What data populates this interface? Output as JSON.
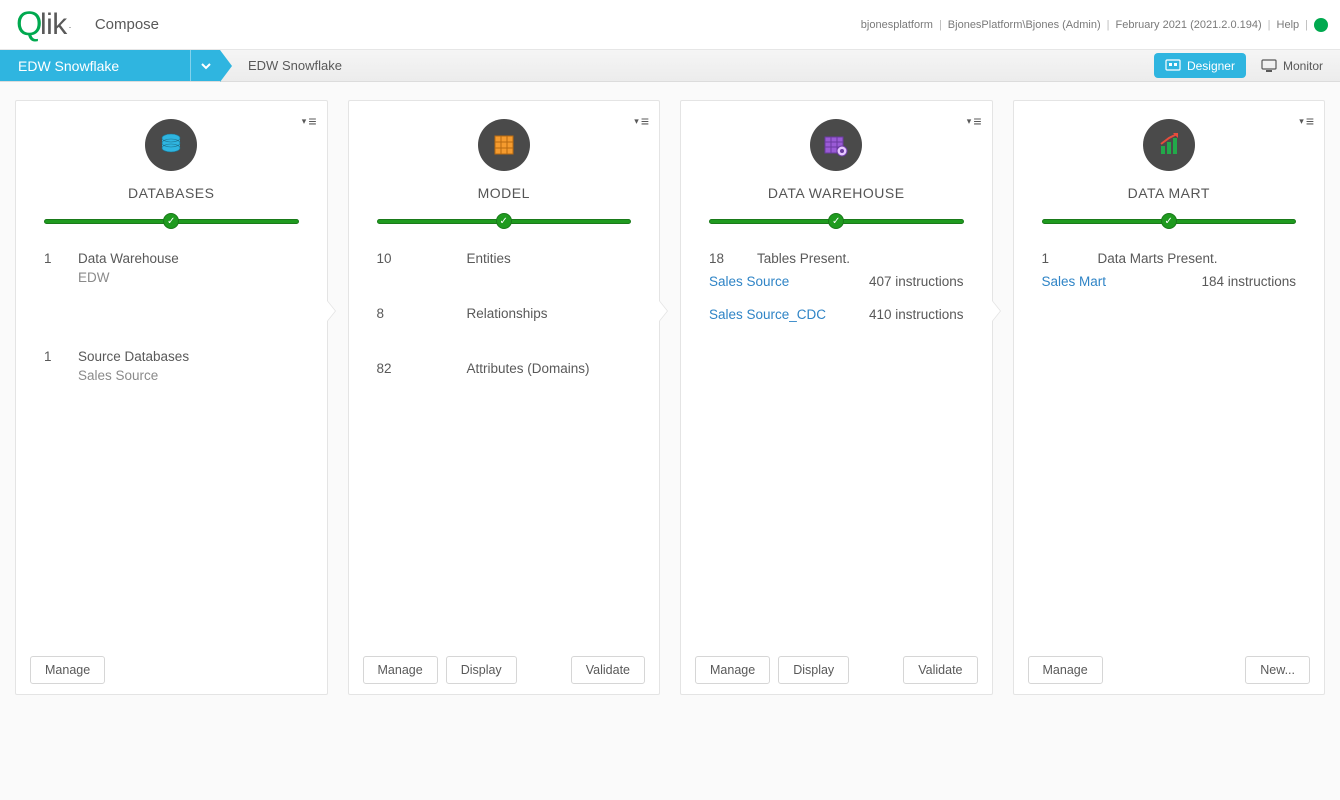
{
  "header": {
    "logo_lik": "lik",
    "app_name": "Compose",
    "platform": "bjonesplatform",
    "user": "BjonesPlatform\\Bjones (Admin)",
    "version": "February 2021 (2021.2.0.194)",
    "help": "Help"
  },
  "nav": {
    "primary": "EDW Snowflake",
    "secondary": "EDW Snowflake",
    "designer": "Designer",
    "monitor": "Monitor"
  },
  "cards": {
    "databases": {
      "title": "DATABASES",
      "dw_count": "1",
      "dw_label": "Data Warehouse",
      "dw_sub": "EDW",
      "src_count": "1",
      "src_label": "Source Databases",
      "src_sub": "Sales Source",
      "btn_manage": "Manage"
    },
    "model": {
      "title": "MODEL",
      "entities_count": "10",
      "entities_label": "Entities",
      "rel_count": "8",
      "rel_label": "Relationships",
      "attr_count": "82",
      "attr_label": "Attributes (Domains)",
      "btn_manage": "Manage",
      "btn_display": "Display",
      "btn_validate": "Validate"
    },
    "dw": {
      "title": "DATA WAREHOUSE",
      "tables_count": "18",
      "tables_label": "Tables Present.",
      "row1_name": "Sales Source",
      "row1_meta": "407 instructions",
      "row2_name": "Sales Source_CDC",
      "row2_meta": "410 instructions",
      "btn_manage": "Manage",
      "btn_display": "Display",
      "btn_validate": "Validate"
    },
    "dm": {
      "title": "DATA MART",
      "marts_count": "1",
      "marts_label": "Data Marts Present.",
      "row1_name": "Sales Mart",
      "row1_meta": "184 instructions",
      "btn_manage": "Manage",
      "btn_new": "New..."
    }
  }
}
